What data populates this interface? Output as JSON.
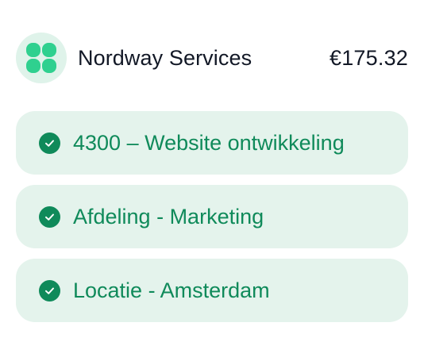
{
  "header": {
    "logo_icon": "clover-sparkle-icon",
    "vendor_name": "Nordway Services",
    "amount": "€175.32"
  },
  "tags": [
    {
      "label": "4300 – Website ontwikkeling",
      "icon": "check-circle-icon"
    },
    {
      "label": "Afdeling - Marketing",
      "icon": "check-circle-icon"
    },
    {
      "label": "Locatie - Amsterdam",
      "icon": "check-circle-icon"
    }
  ],
  "colors": {
    "brand_green": "#0f8a5a",
    "logo_green": "#2fd08f",
    "logo_bg": "#dff3ea",
    "tag_bg": "#e4f3ec",
    "text_dark": "#121826"
  }
}
